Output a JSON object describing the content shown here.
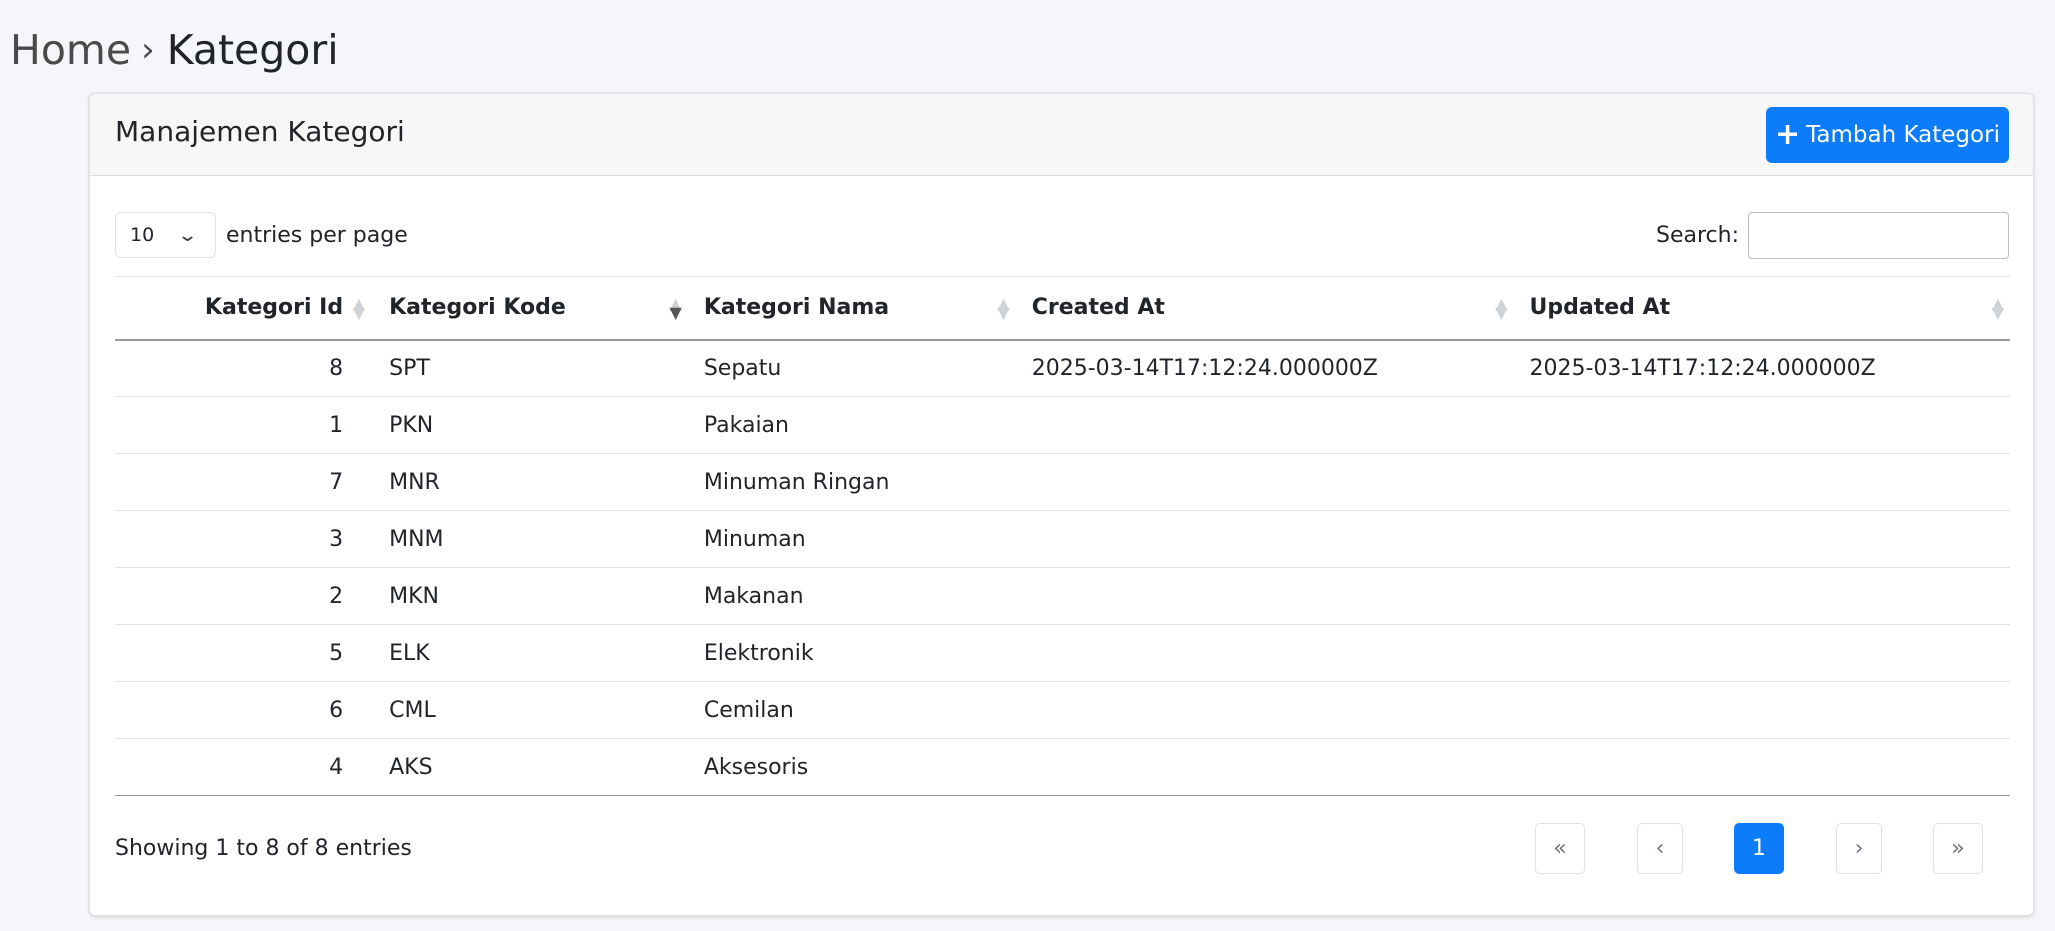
{
  "breadcrumb": {
    "home": "Home",
    "separator": "›",
    "current": "Kategori"
  },
  "card": {
    "title": "Manajemen Kategori",
    "add_button_icon": "plus-icon",
    "add_button_label": "Tambah Kategori"
  },
  "controls": {
    "entries_value": "10",
    "entries_label": "entries per page",
    "search_label": "Search:",
    "search_value": ""
  },
  "table": {
    "columns": [
      "Kategori Id",
      "Kategori Kode",
      "Kategori Nama",
      "Created At",
      "Updated At"
    ],
    "sorted_column": "Kategori Kode",
    "sort_direction": "descending",
    "rows": [
      [
        "8",
        "SPT",
        "Sepatu",
        "2025-03-14T17:12:24.000000Z",
        "2025-03-14T17:12:24.000000Z"
      ],
      [
        "1",
        "PKN",
        "Pakaian",
        "",
        ""
      ],
      [
        "7",
        "MNR",
        "Minuman Ringan",
        "",
        ""
      ],
      [
        "3",
        "MNM",
        "Minuman",
        "",
        ""
      ],
      [
        "2",
        "MKN",
        "Makanan",
        "",
        ""
      ],
      [
        "5",
        "ELK",
        "Elektronik",
        "",
        ""
      ],
      [
        "6",
        "CML",
        "Cemilan",
        "",
        ""
      ],
      [
        "4",
        "AKS",
        "Aksesoris",
        "",
        ""
      ]
    ]
  },
  "footer": {
    "info": "Showing 1 to 8 of 8 entries",
    "pagination": {
      "first": "«",
      "prev": "‹",
      "current": "1",
      "next": "›",
      "last": "»"
    }
  },
  "colors": {
    "accent": "#0d7cfb",
    "background": "#f4f6f9"
  }
}
